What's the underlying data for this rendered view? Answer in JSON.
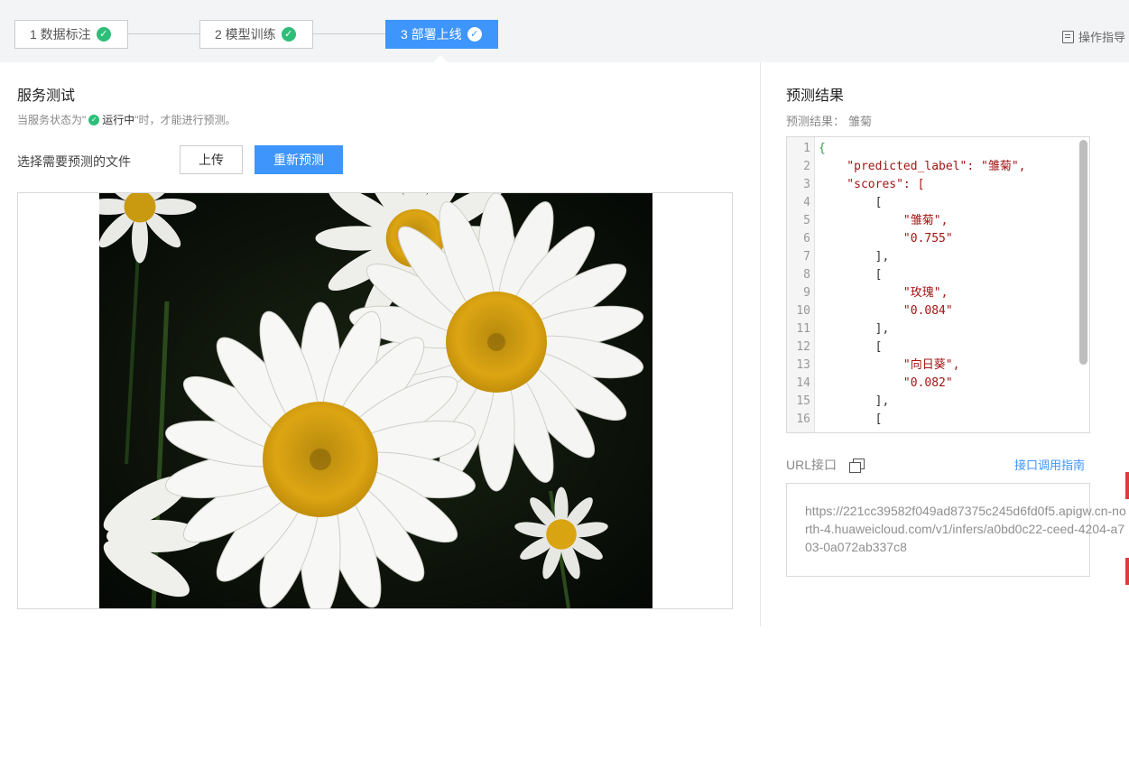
{
  "steps": [
    {
      "label": "1 数据标注",
      "done": true
    },
    {
      "label": "2 模型训练",
      "done": true
    },
    {
      "label": "3 部署上线",
      "done": true
    }
  ],
  "guide_label": "操作指导",
  "service_test": {
    "title": "服务测试",
    "hint_prefix": "当服务状态为\"",
    "hint_status": "运行中",
    "hint_suffix": "\"时，才能进行预测。",
    "file_label": "选择需要预测的文件",
    "upload_label": "上传",
    "repredict_label": "重新预测"
  },
  "prediction": {
    "title": "预测结果",
    "result_label": "预测结果：",
    "result_value": "雏菊",
    "code_lines": [
      {
        "n": "1",
        "t": "{"
      },
      {
        "n": "2",
        "t": "    \"predicted_label\": \"雏菊\","
      },
      {
        "n": "3",
        "t": "    \"scores\": ["
      },
      {
        "n": "4",
        "t": "        ["
      },
      {
        "n": "5",
        "t": "            \"雏菊\","
      },
      {
        "n": "6",
        "t": "            \"0.755\""
      },
      {
        "n": "7",
        "t": "        ],"
      },
      {
        "n": "8",
        "t": "        ["
      },
      {
        "n": "9",
        "t": "            \"玫瑰\","
      },
      {
        "n": "10",
        "t": "            \"0.084\""
      },
      {
        "n": "11",
        "t": "        ],"
      },
      {
        "n": "12",
        "t": "        ["
      },
      {
        "n": "13",
        "t": "            \"向日葵\","
      },
      {
        "n": "14",
        "t": "            \"0.082\""
      },
      {
        "n": "15",
        "t": "        ],"
      },
      {
        "n": "16",
        "t": "        ["
      }
    ]
  },
  "url_section": {
    "label": "URL接口",
    "guide_link": "接口调用指南",
    "url": "https://221cc39582f049ad87375c245d6fd0f5.apigw.cn-north-4.huaweicloud.com/v1/infers/a0bd0c22-ceed-4204-a703-0a072ab337c8"
  },
  "colors": {
    "accent": "#3e95fb",
    "success": "#2fbe7a"
  },
  "icons": [
    "check-icon",
    "guide-doc-icon",
    "copy-icon"
  ]
}
